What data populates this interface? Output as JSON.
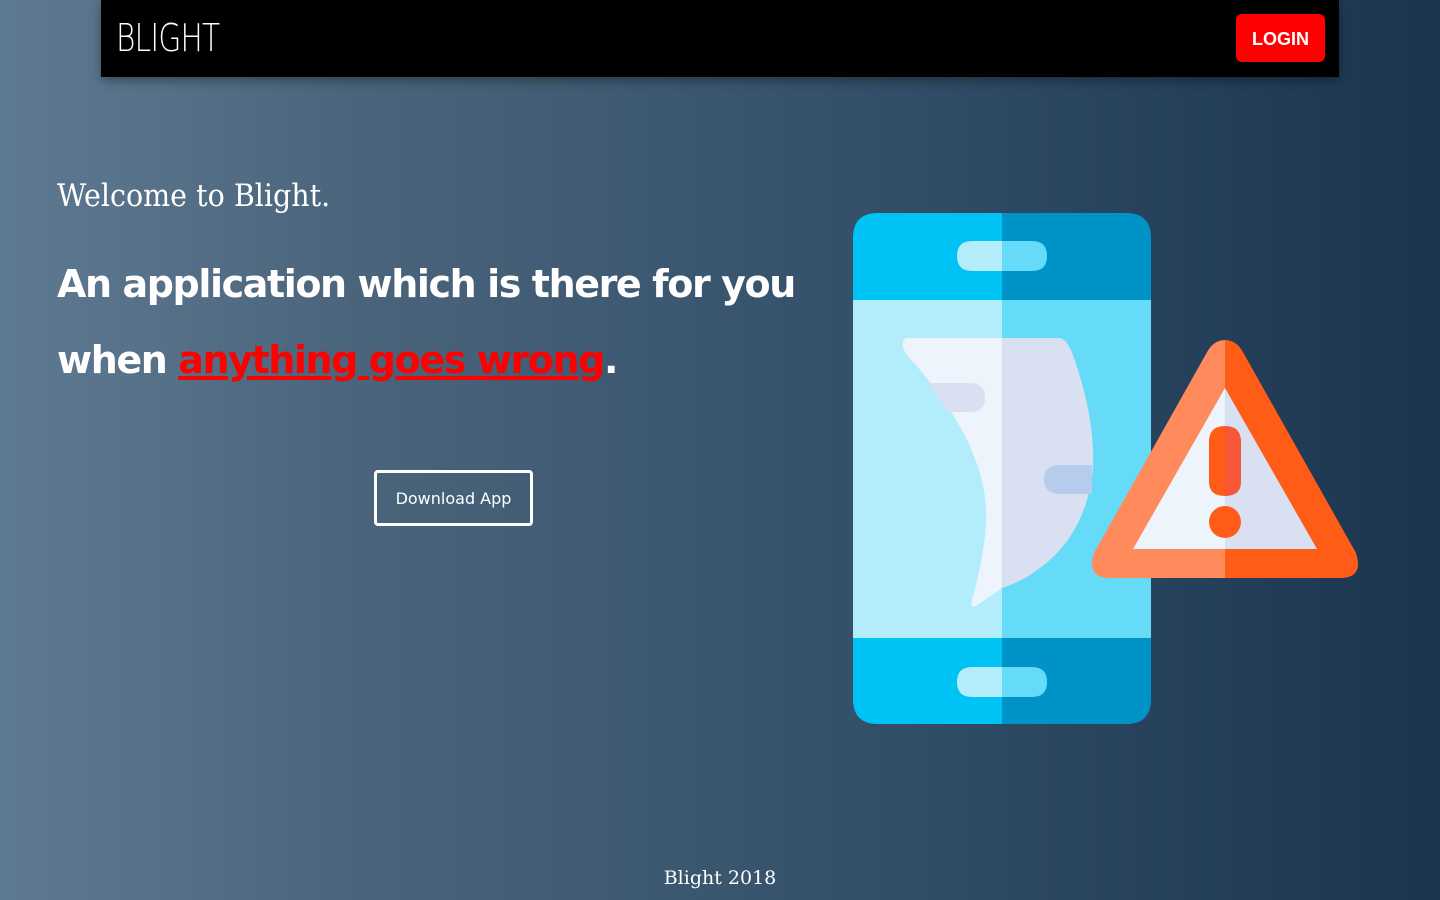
{
  "navbar": {
    "brand": "BLIGHT",
    "login_label": "LOGIN"
  },
  "hero": {
    "welcome": "Welcome to Blight.",
    "headline_part1": "An application which is there for you when ",
    "headline_highlight": "anything goes wrong",
    "headline_end": ".",
    "download_label": "Download App"
  },
  "illustration": {
    "icon": "phone-warning-icon"
  },
  "footer": {
    "text": "Blight 2018"
  },
  "colors": {
    "accent": "#ff0000",
    "navbar_bg": "#000000",
    "phone_blue": "#00c3f5",
    "phone_dark_blue": "#0093c7",
    "warning_orange": "#ff5d17",
    "warning_light": "#ff8a5c"
  }
}
